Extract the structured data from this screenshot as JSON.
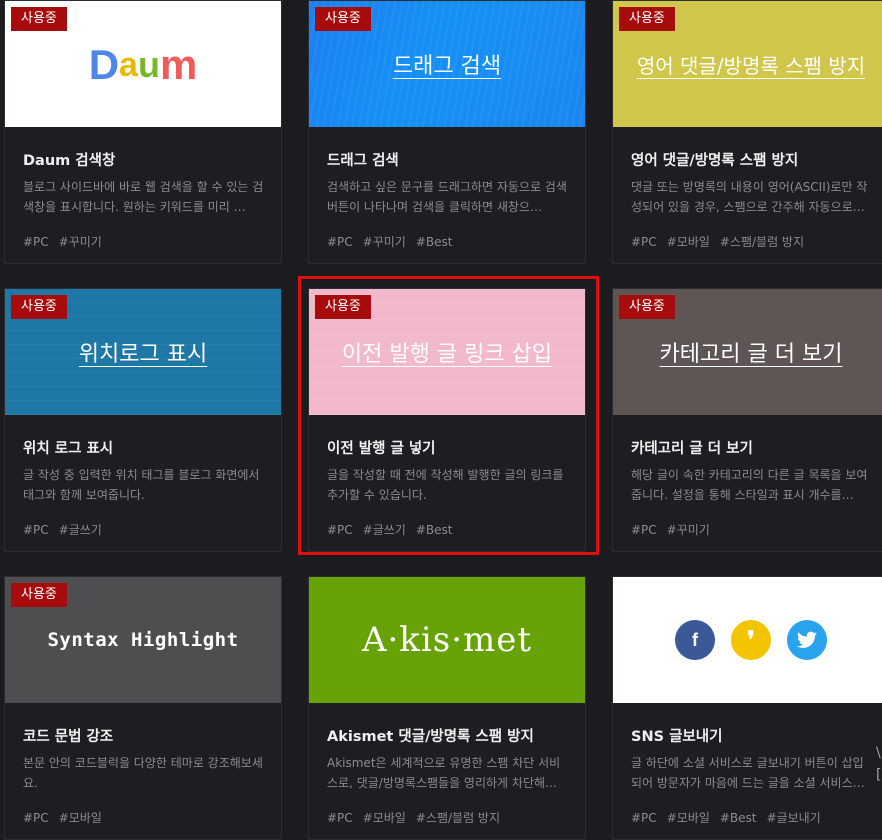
{
  "status_badge": "사용중",
  "cards": [
    {
      "thumb_text": "Daum",
      "title": "Daum 검색창",
      "desc": "블로그 사이드바에 바로 웹 검색을 할 수 있는 검색창을 표시합니다. 원하는 키워드를 미리 …",
      "tags": [
        "#PC",
        "#꾸미기"
      ]
    },
    {
      "thumb_text": "드래그 검색",
      "title": "드래그 검색",
      "desc": "검색하고 싶은 문구를 드래그하면 자동으로 검색 버튼이 나타나며 검색을 클릭하면 새창으…",
      "tags": [
        "#PC",
        "#꾸미기",
        "#Best"
      ]
    },
    {
      "thumb_text": "영어 댓글/방명록 스팸 방지",
      "title": "영어 댓글/방명록 스팸 방지",
      "desc": "댓글 또는 방명록의 내용이 영어(ASCII)로만 작성되어 있을 경우, 스팸으로 간주해 자동으로…",
      "tags": [
        "#PC",
        "#모바일",
        "#스팸/블럼 방지"
      ]
    },
    {
      "thumb_text": "위치로그 표시",
      "title": "위치 로그 표시",
      "desc": "글 작성 중 입력한 위치 태그를 블로그 화면에서 태그와 함께 보여줍니다.",
      "tags": [
        "#PC",
        "#글쓰기"
      ]
    },
    {
      "thumb_text": "이전 발행 글 링크 삽입",
      "title": "이전 발행 글 넣기",
      "desc": "글을 작성할 때 전에 작성해 발행한 글의 링크를 추가할 수 있습니다.",
      "tags": [
        "#PC",
        "#글쓰기",
        "#Best"
      ]
    },
    {
      "thumb_text": "카테고리 글 더 보기",
      "title": "카테고리 글 더 보기",
      "desc": "해당 글이 속한 카테고리의 다른 글 목록을 보여줍니다. 설정을 통해 스타일과 표시 개수를…",
      "tags": [
        "#PC",
        "#꾸미기"
      ]
    },
    {
      "thumb_text": "Syntax Highlight",
      "title": "코드 문법 강조",
      "desc": "본문 안의 코드블럭을 다양한 테마로 강조해보세요.",
      "tags": [
        "#PC",
        "#모바일"
      ]
    },
    {
      "thumb_text": "A·kis·met",
      "title": "Akismet 댓글/방명록 스팸 방지",
      "desc": "Akismet은 세계적으로 유명한 스팸 차단 서비스로, 댓글/방명록스팸들을 영리하게 차단해…",
      "tags": [
        "#PC",
        "#모바일",
        "#스팸/블럼 방지"
      ]
    },
    {
      "thumb_text": "",
      "title": "SNS 글보내기",
      "desc": "글 하단에 소셜 서비스로 글보내기 버튼이 삽입되어 방문자가 마음에 드는 글을 소셜 서비스…",
      "tags": [
        "#PC",
        "#모바일",
        "#Best",
        "#글보내기"
      ]
    }
  ],
  "sns_icons": [
    {
      "name": "facebook",
      "glyph": "f",
      "color": "#3b5998"
    },
    {
      "name": "kakaostory",
      "glyph": "❜",
      "color": "#f5c400"
    },
    {
      "name": "twitter",
      "glyph": "🐦",
      "color": "#2aa3ef"
    }
  ],
  "edge_fragment": [
    "\\",
    "["
  ],
  "colors": {
    "badge": "#a70c0c",
    "highlight": "#e10f0f",
    "page_bg": "#1b1c1f"
  }
}
